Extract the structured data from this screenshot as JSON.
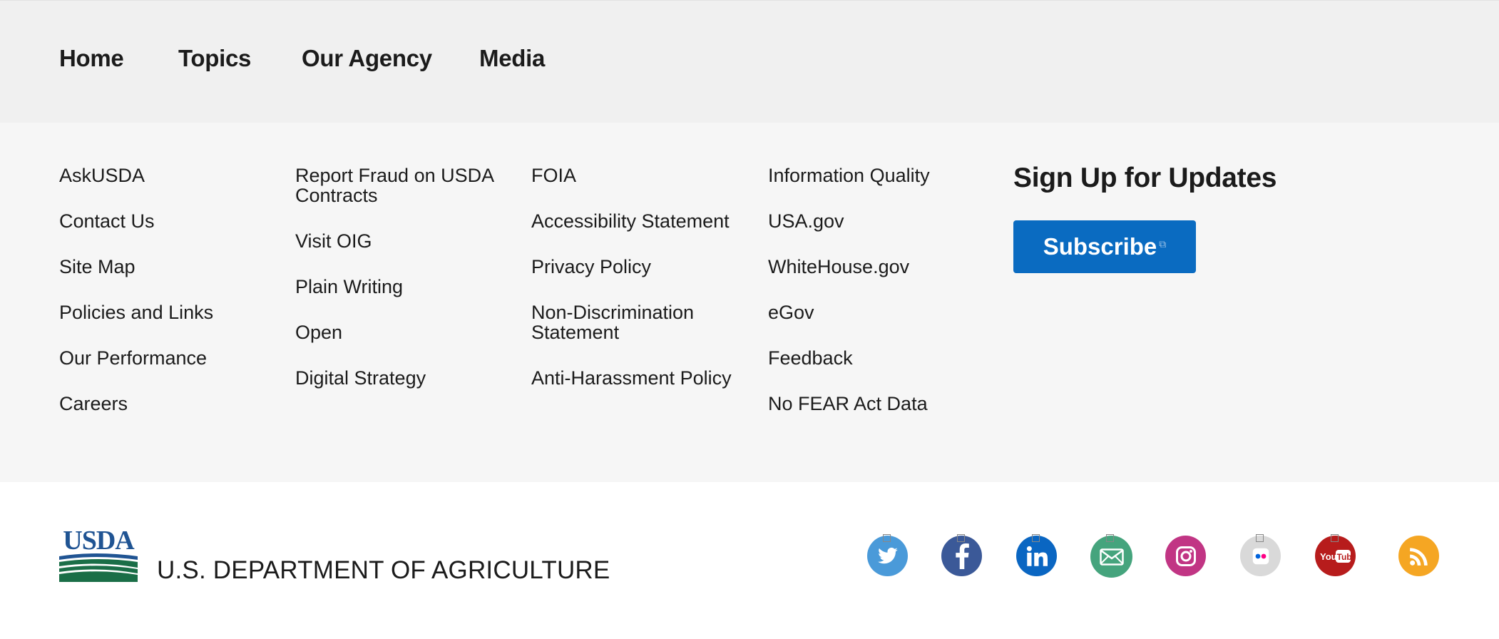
{
  "topnav": {
    "items": [
      {
        "label": "Home"
      },
      {
        "label": "Topics"
      },
      {
        "label": "Our Agency"
      },
      {
        "label": "Media"
      }
    ]
  },
  "footer_links": {
    "col1": [
      "AskUSDA",
      "Contact Us",
      "Site Map",
      "Policies and Links",
      "Our Performance",
      "Careers"
    ],
    "col2": [
      "Report Fraud on USDA Contracts",
      "Visit OIG",
      "Plain Writing",
      "Open",
      "Digital Strategy"
    ],
    "col3": [
      "FOIA",
      "Accessibility Statement",
      "Privacy Policy",
      "Non-Discrimination Statement",
      "Anti-Harassment Policy"
    ],
    "col4": [
      "Information Quality",
      "USA.gov",
      "WhiteHouse.gov",
      "eGov",
      "Feedback",
      "No FEAR Act Data"
    ]
  },
  "signup": {
    "title": "Sign Up for Updates",
    "button_label": "Subscribe"
  },
  "identity": {
    "logo_text": "USDA",
    "agency_name": "U.S. DEPARTMENT OF AGRICULTURE"
  },
  "social": [
    {
      "icon": "twitter-icon",
      "color": "#4a9ad9"
    },
    {
      "icon": "facebook-icon",
      "color": "#3b5998"
    },
    {
      "icon": "linkedin-icon",
      "color": "#0a66c2"
    },
    {
      "icon": "email-icon",
      "color": "#45a47d"
    },
    {
      "icon": "instagram-icon",
      "color": "#c13584"
    },
    {
      "icon": "flickr-icon",
      "color": "#d9d9d9"
    },
    {
      "icon": "youtube-icon",
      "color": "#b71c1c"
    },
    {
      "icon": "rss-icon",
      "color": "#f5a623"
    }
  ],
  "colors": {
    "subscribe_bg": "#0a6bc1",
    "topnav_bg": "#f0f0f0",
    "links_bg": "#f6f6f6",
    "usda_blue": "#205493",
    "usda_green": "#1a6e47"
  }
}
